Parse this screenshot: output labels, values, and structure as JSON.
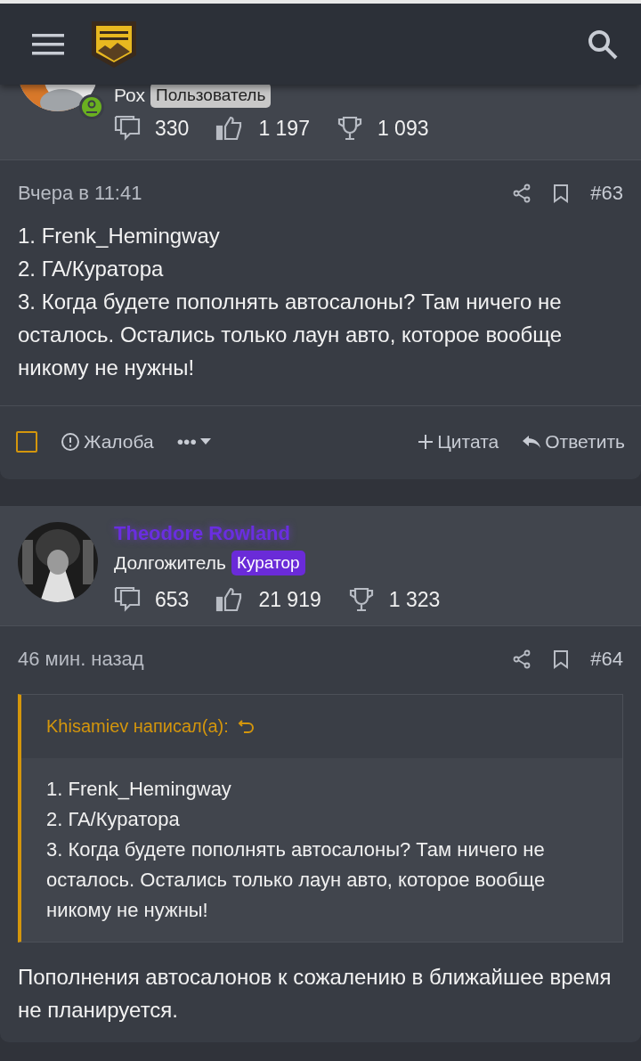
{
  "posts": [
    {
      "author": {
        "title": "Рох",
        "badge": {
          "text": "Пользователь",
          "color": "#c8c8c8"
        },
        "online": true
      },
      "stats": {
        "messages": "330",
        "likes": "1 197",
        "points": "1 093"
      },
      "date": "Вчера в 11:41",
      "number": "#63",
      "body": [
        "1. Frenk_Hemingway",
        "2. ГА/Куратора",
        "3. Когда будете пополнять автосалоны? Там ничего не осталось. Остались только лаун авто, которое вообще никому не нужны!"
      ],
      "actions": {
        "select_checked": false,
        "report": "Жалоба",
        "more": "•••",
        "quote": "Цитата",
        "reply": "Ответить"
      }
    },
    {
      "author": {
        "name": "Theodore Rowland",
        "title": "Долгожитель",
        "badge": {
          "text": "Куратор",
          "color": "#6a2bd8"
        },
        "online": false
      },
      "stats": {
        "messages": "653",
        "likes": "21 919",
        "points": "1 323"
      },
      "date": "46 мин. назад",
      "number": "#64",
      "quote": {
        "author": "Khisamiev написал(а):",
        "lines": [
          "1. Frenk_Hemingway",
          "2. ГА/Куратора",
          "3. Когда будете пополнять автосалоны? Там ничего не осталось. Остались только лаун авто, которое вообще никому не нужны!"
        ]
      },
      "body": [
        "Пополнения автосалонов к сожалению в ближайшее время не планируется."
      ]
    }
  ]
}
